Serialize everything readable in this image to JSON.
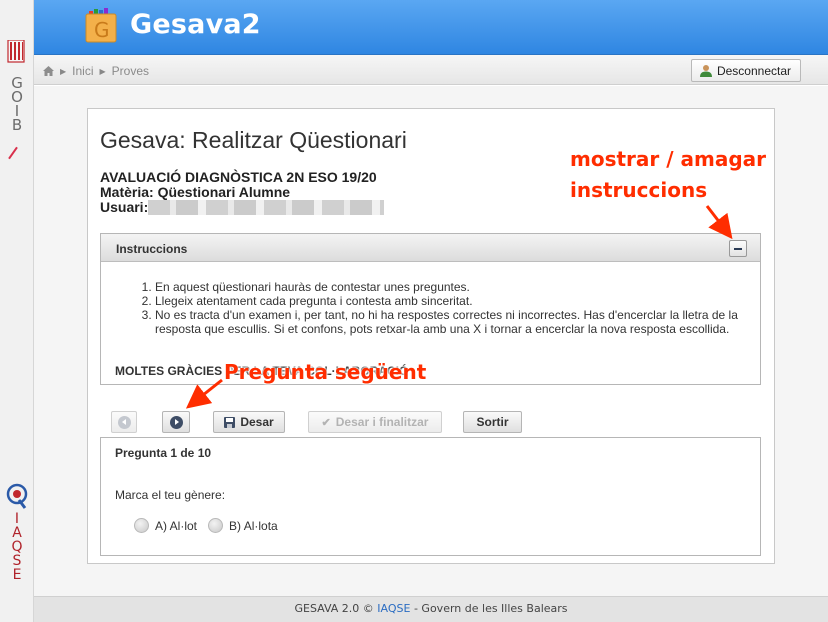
{
  "sidebar": {
    "goib_letters": [
      "G",
      "O",
      "I",
      "B"
    ],
    "iaqse_letters": [
      "I",
      "A",
      "Q",
      "S",
      "E"
    ]
  },
  "header": {
    "logo_letter": "G",
    "brand": "Gesava2"
  },
  "breadcrumb": {
    "items": [
      "Inici",
      "Proves"
    ]
  },
  "logout_label": "Desconnectar",
  "page": {
    "title": "Gesava: Realitzar Qüestionari",
    "evaluation": "AVALUACIÓ DIAGNÒSTICA 2N ESO 19/20",
    "subject": "Matèria: Qüestionari Alumne",
    "user_label": "Usuari:"
  },
  "instructions": {
    "header": "Instruccions",
    "items": [
      "En aquest qüestionari hauràs de contestar unes preguntes.",
      "Llegeix atentament cada pregunta i contesta amb sinceritat.",
      "No es tracta d'un examen i, per tant, no hi ha respostes correctes ni incorrectes. Has d'encerclar la lletra de la resposta que escullis. Si et confons, pots retxar-la amb una X i tornar a encerclar la nova resposta escollida."
    ],
    "thanks": "MOLTES GRÀCIES PER LA TEVA COL·LABORACIÓ"
  },
  "toolbar": {
    "save": "Desar",
    "save_finish": "Desar i finalitzar",
    "exit": "Sortir"
  },
  "question": {
    "number": "Pregunta 1 de 10",
    "text": "Marca el teu gènere:",
    "options": [
      "A) Al·lot",
      "B) Al·lota"
    ]
  },
  "annotations": {
    "toggle_line1": "mostrar / amagar",
    "toggle_line2": "instruccions",
    "next": "Pregunta següent"
  },
  "footer": {
    "prefix": "GESAVA 2.0 © ",
    "link": "IAQSE",
    "suffix": " - Govern de les Illes Balears"
  },
  "colors": {
    "header_blue": "#3d91e8",
    "annotation": "#ff2d00",
    "iaqse_red": "#b0232b"
  },
  "icons": [
    "home-icon",
    "chevron-right-icon",
    "user-icon",
    "minus-icon",
    "prev-icon",
    "next-icon",
    "floppy-icon",
    "check-icon"
  ]
}
